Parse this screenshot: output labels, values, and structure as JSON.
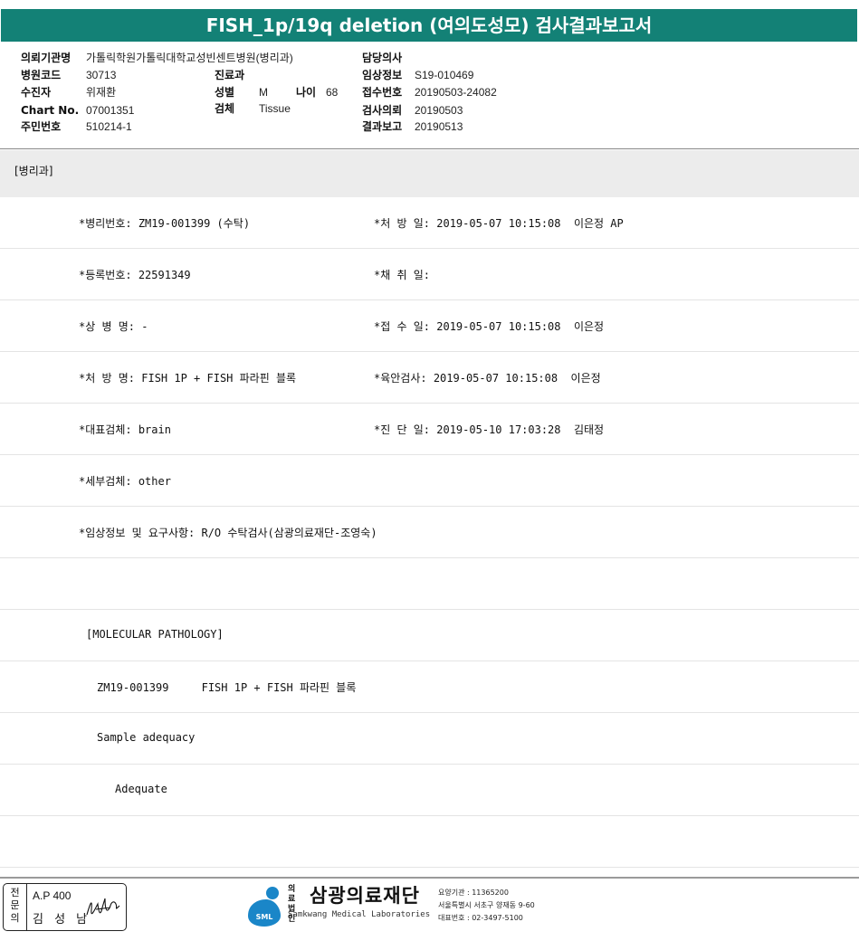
{
  "title": "FISH_1p/19q deletion (여의도성모) 검사결과보고서",
  "info": {
    "hospital_label": "의뢰기관명",
    "hospital_value": "가톨릭학원가톨릭대학교성빈센트병원(병리과)",
    "code_label": "병원코드",
    "code_value": "30713",
    "recipient_label": "수진자",
    "recipient_value": "위재환",
    "chart_label": "Chart No.",
    "chart_value": "07001351",
    "id_label": "주민번호",
    "id_value": "510214-1",
    "dept_label": "진료과",
    "dept_value": "",
    "sex_label": "성별",
    "sex_value": "M",
    "age_label": "나이",
    "age_value": "68",
    "specimen_label": "검체",
    "specimen_value": "Tissue",
    "doctor_label": "담당의사",
    "doctor_value": "",
    "clinical_label": "임상정보",
    "clinical_value": "S19-010469",
    "receipt_label": "접수번호",
    "receipt_value": "20190503-24082",
    "request_label": "검사의뢰",
    "request_value": "20190503",
    "report_label": "결과보고",
    "report_value": "20190513"
  },
  "section": "[병리과]",
  "rows": [
    {
      "left": "*병리번호: ZM19-001399 (수탁)",
      "right": "*처 방 일: 2019-05-07 10:15:08  이은정 AP"
    },
    {
      "left": "*등록번호: 22591349",
      "right": "*채 취 일:"
    },
    {
      "left": "*상 병 명: -",
      "right": "*접 수 일: 2019-05-07 10:15:08  이은정"
    },
    {
      "left": "*처 방 명: FISH 1P + FISH 파라핀 블록",
      "right": "*육안검사: 2019-05-07 10:15:08  이은정"
    },
    {
      "left": "*대표검체: brain",
      "right": "*진 단 일: 2019-05-10 17:03:28  김태정"
    },
    {
      "left": "*세부검체: other",
      "right": ""
    },
    {
      "left": "*임상정보 및 요구사항: R/O 수탁검사(삼광의료재단-조영숙)",
      "right": ""
    },
    {
      "left": "",
      "right": ""
    },
    {
      "left": "[MOLECULAR PATHOLOGY]",
      "right": ""
    },
    {
      "left": "ZM19-001399     FISH 1P + FISH 파라핀 블록",
      "right": ""
    },
    {
      "left": "Sample adequacy",
      "right": ""
    },
    {
      "left": "Adequate",
      "right": ""
    },
    {
      "left": "",
      "right": ""
    }
  ],
  "footer": {
    "stamp_vertical": "전문의",
    "stamp_ap": "A.P 400",
    "stamp_name": "김 성 남",
    "org_small": "의료\n법인",
    "org_name": "삼광의료재단",
    "org_eng": "Samkwang Medical Laboratories",
    "logo_text": "SML",
    "contact_code": "요양기관 : 11365200",
    "contact_address": "서울특별시 서초구 양재동 9-60",
    "contact_phone": "대표번호 : 02-3497-5100"
  }
}
